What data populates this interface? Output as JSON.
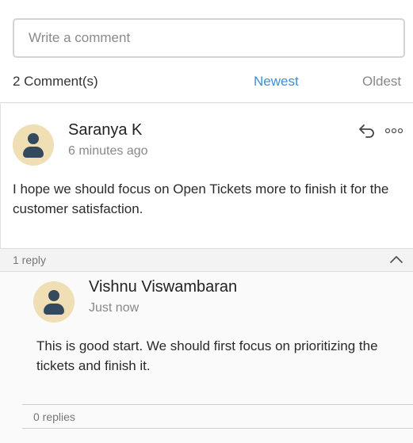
{
  "composer": {
    "placeholder": "Write a comment"
  },
  "header": {
    "count_label": "2 Comment(s)",
    "sort_newest": "Newest",
    "sort_oldest": "Oldest"
  },
  "comment": {
    "author": "Saranya K",
    "time": "6 minutes ago",
    "text": "I hope we should focus on Open Tickets more to finish it for the customer satisfaction.",
    "reply_count": "1 reply",
    "icons": [
      "reply-icon",
      "more-options-icon",
      "collapse-chevron-icon"
    ]
  },
  "reply": {
    "author": "Vishnu Viswambaran",
    "time": "Just now",
    "text": "This is good start. We should first focus on prioritizing the tickets and finish it.",
    "reply_count": "0 replies"
  },
  "colors": {
    "accent": "#3d8ddc",
    "avatar_bg": "#f0deb5",
    "avatar_fg": "#34495e"
  }
}
